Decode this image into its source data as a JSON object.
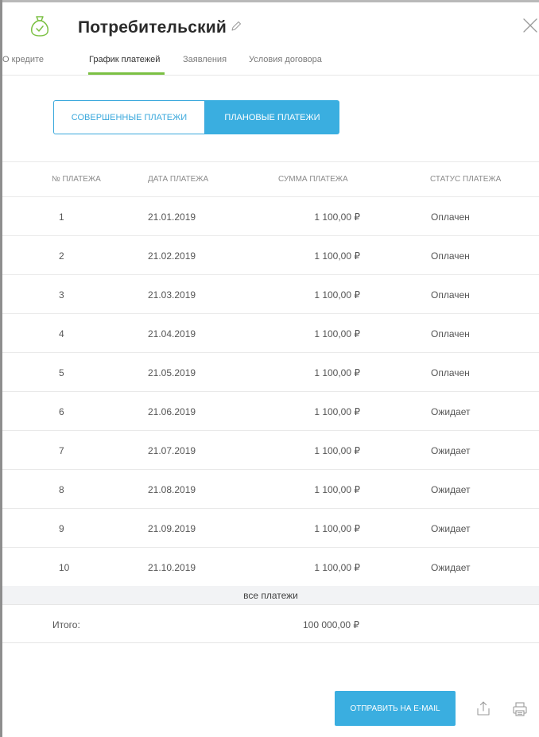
{
  "header": {
    "title": "Потребительский",
    "title_icon": "money-bag-icon",
    "edit_icon": "pencil-icon",
    "close_icon": "close-icon"
  },
  "tabs": [
    {
      "label": "О кредите",
      "active": false
    },
    {
      "label": "График платежей",
      "active": true
    },
    {
      "label": "Заявления",
      "active": false
    },
    {
      "label": "Условия договора",
      "active": false
    }
  ],
  "segment": {
    "left_label": "Совершенные платежи",
    "right_label": "Плановые платежи",
    "selected": "Плановые платежи"
  },
  "table": {
    "headers": [
      "№ платежа",
      "Дата платежа",
      "Сумма платежа",
      "Статус платежа"
    ],
    "rows": [
      {
        "num": "1",
        "date": "21.01.2019",
        "sum": "1 100,00 ₽",
        "status": "Оплачен"
      },
      {
        "num": "2",
        "date": "21.02.2019",
        "sum": "1 100,00 ₽",
        "status": "Оплачен"
      },
      {
        "num": "3",
        "date": "21.03.2019",
        "sum": "1 100,00 ₽",
        "status": "Оплачен"
      },
      {
        "num": "4",
        "date": "21.04.2019",
        "sum": "1 100,00 ₽",
        "status": "Оплачен"
      },
      {
        "num": "5",
        "date": "21.05.2019",
        "sum": "1 100,00 ₽",
        "status": "Оплачен"
      },
      {
        "num": "6",
        "date": "21.06.2019",
        "sum": "1 100,00 ₽",
        "status": "Ожидает"
      },
      {
        "num": "7",
        "date": "21.07.2019",
        "sum": "1 100,00 ₽",
        "status": "Ожидает"
      },
      {
        "num": "8",
        "date": "21.08.2019",
        "sum": "1 100,00 ₽",
        "status": "Ожидает"
      },
      {
        "num": "9",
        "date": "21.09.2019",
        "sum": "1 100,00 ₽",
        "status": "Ожидает"
      },
      {
        "num": "10",
        "date": "21.10.2019",
        "sum": "1 100,00 ₽",
        "status": "Ожидает"
      }
    ],
    "all_payments_label": "все платежи",
    "total_label": "Итого:",
    "total_value": "100 000,00 ₽"
  },
  "footer": {
    "send_label": "Отправить на e-mail",
    "share_icon": "share-icon",
    "print_icon": "print-icon"
  },
  "colors": {
    "accent": "#3aaee0",
    "tab_underline": "#7bc043",
    "icon_green": "#7bc043"
  }
}
